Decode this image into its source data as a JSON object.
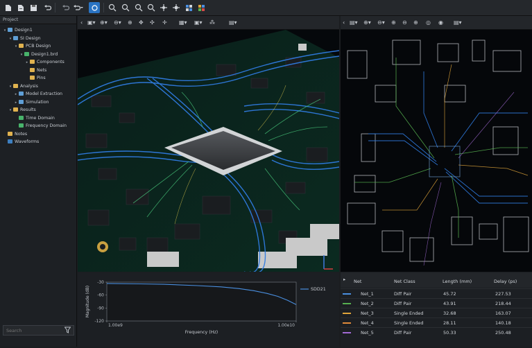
{
  "project": {
    "header": "Project",
    "tree": [
      {
        "label": "Design1",
        "depth": 0,
        "icon": "doc",
        "twisty": "▾"
      },
      {
        "label": "SI Design",
        "depth": 1,
        "icon": "doc",
        "twisty": "▾"
      },
      {
        "label": "PCB Design",
        "depth": 2,
        "icon": "folder",
        "twisty": "▾"
      },
      {
        "label": "Design1.brd",
        "depth": 3,
        "icon": "green",
        "twisty": "▾"
      },
      {
        "label": "Components",
        "depth": 4,
        "icon": "folder",
        "twisty": "▸"
      },
      {
        "label": "Nets",
        "depth": 4,
        "icon": "folder",
        "twisty": ""
      },
      {
        "label": "Pins",
        "depth": 4,
        "icon": "folder",
        "twisty": ""
      },
      {
        "label": "Analysis",
        "depth": 1,
        "icon": "folder",
        "twisty": "▾"
      },
      {
        "label": "Model Extraction",
        "depth": 2,
        "icon": "doc",
        "twisty": "▸"
      },
      {
        "label": "Simulation",
        "depth": 2,
        "icon": "doc",
        "twisty": "▸"
      },
      {
        "label": "Results",
        "depth": 1,
        "icon": "folder",
        "twisty": "▾"
      },
      {
        "label": "Time Domain",
        "depth": 2,
        "icon": "green",
        "twisty": ""
      },
      {
        "label": "Frequency Domain",
        "depth": 2,
        "icon": "green",
        "twisty": ""
      },
      {
        "label": "Notes",
        "depth": 0,
        "icon": "folder",
        "twisty": ""
      },
      {
        "label": "Waveforms",
        "depth": 0,
        "icon": "wave",
        "twisty": ""
      }
    ],
    "search_placeholder": "Search"
  },
  "colors": {
    "accent": "#4a8fe0",
    "trace_blue": "#2f7be0",
    "board_green": "#143a2a",
    "net_colors": [
      "#4a8fe0",
      "#56b04f",
      "#e0a53a",
      "#e08a3a",
      "#a36ad6"
    ]
  },
  "plot": {
    "legend": "SDD21",
    "ylabel": "Magnitude (dB)",
    "xlabel": "Frequency (Hz)",
    "y_ticks": [
      "-30",
      "-60",
      "-90",
      "-120"
    ],
    "x_ticks": [
      "1.00e9",
      "1.00e10"
    ]
  },
  "chart_data": {
    "type": "line",
    "title": "",
    "xlabel": "Frequency (Hz)",
    "ylabel": "Magnitude (dB)",
    "xscale": "log",
    "xlim": [
      1000000000,
      10000000000
    ],
    "ylim": [
      -120,
      -30
    ],
    "series": [
      {
        "name": "SDD21",
        "x": [
          1000000000,
          1500000000,
          2000000000,
          3000000000,
          4000000000,
          5000000000,
          6000000000,
          7000000000,
          8000000000,
          9000000000,
          10000000000
        ],
        "y": [
          -33,
          -34,
          -35,
          -38,
          -41,
          -45,
          -50,
          -56,
          -63,
          -72,
          -82
        ]
      }
    ]
  },
  "net_table": {
    "headers": [
      "Net",
      "Net Class",
      "Length (mm)",
      "Delay (ps)"
    ],
    "rows": [
      {
        "net": "Net_1",
        "net_class": "Diff Pair",
        "length": "45.72",
        "delay": "227.53",
        "color": "#4a8fe0"
      },
      {
        "net": "Net_2",
        "net_class": "Diff Pair",
        "length": "43.91",
        "delay": "218.44",
        "color": "#56b04f"
      },
      {
        "net": "Net_3",
        "net_class": "Single Ended",
        "length": "32.68",
        "delay": "163.07",
        "color": "#e0a53a"
      },
      {
        "net": "Net_4",
        "net_class": "Single Ended",
        "length": "28.11",
        "delay": "140.18",
        "color": "#e08a3a"
      },
      {
        "net": "Net_5",
        "net_class": "Diff Pair",
        "length": "50.33",
        "delay": "250.48",
        "color": "#a36ad6"
      }
    ]
  },
  "icons": {
    "toolbar": [
      "new-file-icon",
      "open-file-icon",
      "save-icon",
      "save-all-icon",
      "undo-icon",
      "undo-icon",
      "undo-dropdown-icon",
      "refresh-icon",
      "zoom-in-icon",
      "zoom-out-icon",
      "zoom-fit-icon",
      "zoom-area-icon",
      "pan-icon",
      "select-icon",
      "layout-icon",
      "color-grid-icon"
    ]
  }
}
